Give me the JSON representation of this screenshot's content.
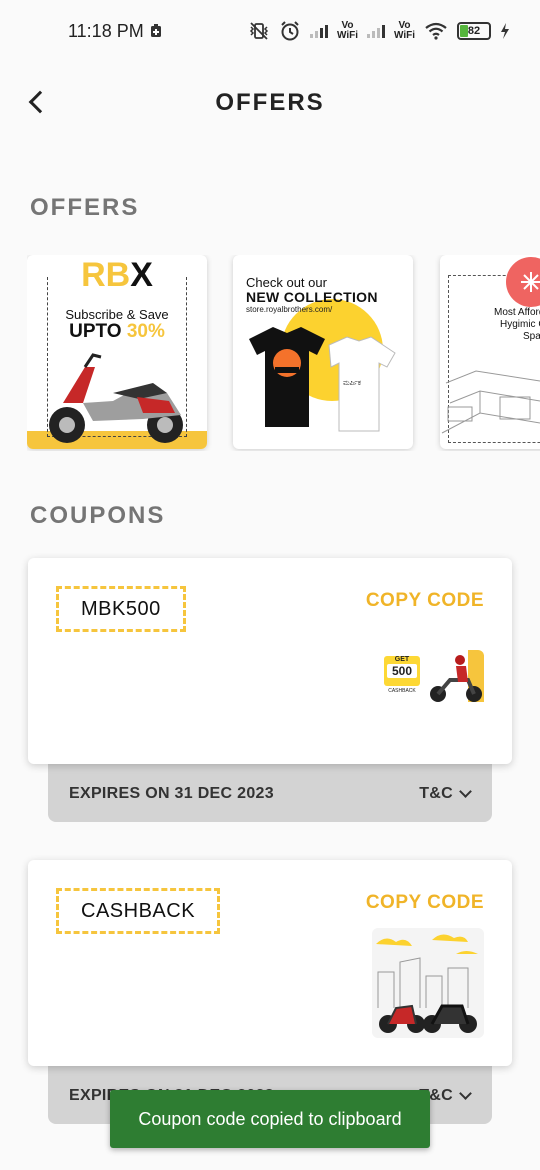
{
  "status_bar": {
    "time": "11:18 PM",
    "battery": "82",
    "vowifi_label_top": "Vo",
    "vowifi_label_bottom": "WiFi"
  },
  "header": {
    "title": "OFFERS"
  },
  "offers_section": {
    "title": "OFFERS",
    "cards": [
      {
        "brand_r": "RB",
        "brand_x": "X",
        "line1": "Subscribe & Save",
        "line2_prefix": "UPTO",
        "line2_highlight": "30%"
      },
      {
        "line1": "Check out our",
        "line2": "NEW COLLECTION",
        "url": "store.royalbrothers.com/"
      },
      {
        "line1": "Most Afford",
        "line2": "Hygimic Co",
        "line3": "Space"
      }
    ]
  },
  "coupons_section": {
    "title": "COUPONS",
    "coupons": [
      {
        "code": "MBK500",
        "copy_label": "COPY CODE",
        "expiry": "EXPIRES ON 31 DEC 2023",
        "tnc_label": "T&C",
        "promo_get": "GET",
        "promo_amount": "500",
        "promo_cashback": "CASHBACK"
      },
      {
        "code": "CASHBACK",
        "copy_label": "COPY CODE",
        "expiry": "EXPIRES ON 31 DEC 2023",
        "tnc_label": "T&C"
      }
    ]
  },
  "toast": {
    "message": "Coupon code copied to clipboard"
  },
  "colors": {
    "accent_yellow": "#f6c53d",
    "toast_green": "#2e7d32",
    "footer_grey": "#d3d3d3"
  }
}
